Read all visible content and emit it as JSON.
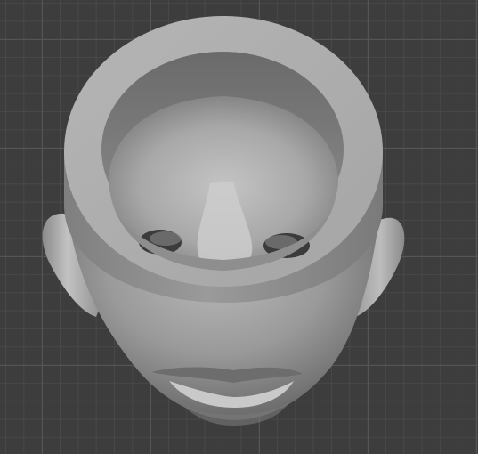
{
  "viewport": {
    "background_color": "#3d3d3d",
    "grid_minor_color": "#484848",
    "grid_major_color": "#555555"
  },
  "model": {
    "name": "head-sculpt-with-ring-cut",
    "base_color": "#9c9c9c",
    "highlight_color": "#c8c8c8",
    "shadow_color": "#5a5a5a"
  }
}
